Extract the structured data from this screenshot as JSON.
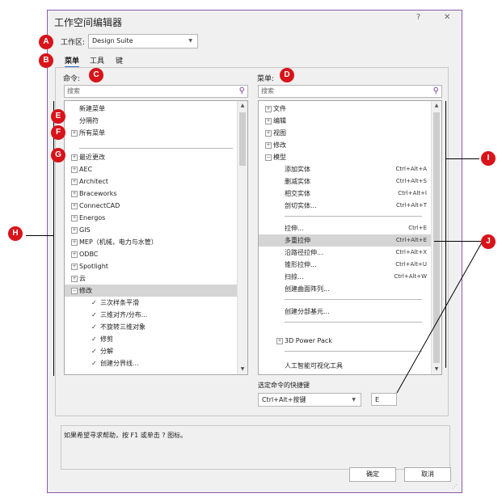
{
  "window": {
    "title": "工作空间编辑器",
    "help_btn": "?",
    "close_btn": "✕"
  },
  "workspace": {
    "label": "工作区:",
    "value": "Design Suite"
  },
  "tabs": [
    {
      "label": "菜单"
    },
    {
      "label": "工具"
    },
    {
      "label": "键"
    }
  ],
  "left": {
    "label": "命令:",
    "search_placeholder": "搜索",
    "items": [
      {
        "text": "新建菜单"
      },
      {
        "text": "分隔符"
      },
      {
        "text": "所有菜单"
      },
      {
        "text": "最近更改"
      },
      {
        "text": "AEC"
      },
      {
        "text": "Architect"
      },
      {
        "text": "Braceworks"
      },
      {
        "text": "ConnectCAD"
      },
      {
        "text": "Energos"
      },
      {
        "text": "GIS"
      },
      {
        "text": "MEP（机械，电力与水管）"
      },
      {
        "text": "ODBC"
      },
      {
        "text": "Spotlight"
      },
      {
        "text": "云"
      },
      {
        "text": "修改"
      },
      {
        "text": "三次样条平滑"
      },
      {
        "text": "三维对齐/分布..."
      },
      {
        "text": "不旋转三维对象"
      },
      {
        "text": "修剪"
      },
      {
        "text": "分解"
      },
      {
        "text": "创建分界线..."
      }
    ]
  },
  "right": {
    "label": "菜单:",
    "search_placeholder": "搜索",
    "items": [
      {
        "text": "文件"
      },
      {
        "text": "编辑"
      },
      {
        "text": "视图"
      },
      {
        "text": "修改"
      },
      {
        "text": "模型"
      },
      {
        "text": "添加实体",
        "shortcut": "Ctrl+Alt+A"
      },
      {
        "text": "删减实体",
        "shortcut": "Ctrl+Alt+S"
      },
      {
        "text": "相交实体",
        "shortcut": "Ctrl+Alt+I"
      },
      {
        "text": "剖切实体...",
        "shortcut": "Ctrl+Alt+T"
      },
      {
        "text": "拉伸...",
        "shortcut": "Ctrl+E"
      },
      {
        "text": "多重拉伸",
        "shortcut": "Ctrl+Alt+E"
      },
      {
        "text": "沿路径拉伸...",
        "shortcut": "Ctrl+Alt+X"
      },
      {
        "text": "锥形拉伸...",
        "shortcut": "Ctrl+Alt+U"
      },
      {
        "text": "扫掠...",
        "shortcut": "Ctrl+Alt+W"
      },
      {
        "text": "创建曲面阵列..."
      },
      {
        "text": "创建分部基元..."
      },
      {
        "text": "3D Power Pack"
      },
      {
        "text": "人工智能可视化工具"
      }
    ],
    "shortcut_label": "选定命令的快捷键",
    "shortcut_value": "Ctrl+Alt+按键",
    "shortcut_key": "E"
  },
  "help_text": "如果希望寻求帮助，按 F1 或单击 ? 图标。",
  "buttons": {
    "ok": "确定",
    "cancel": "取消"
  },
  "callouts": [
    "A",
    "B",
    "C",
    "D",
    "E",
    "F",
    "G",
    "H",
    "I",
    "J"
  ],
  "colors": {
    "badge": "#d8131a",
    "border": "#8c5aa8",
    "selection": "#d5d5d5"
  }
}
